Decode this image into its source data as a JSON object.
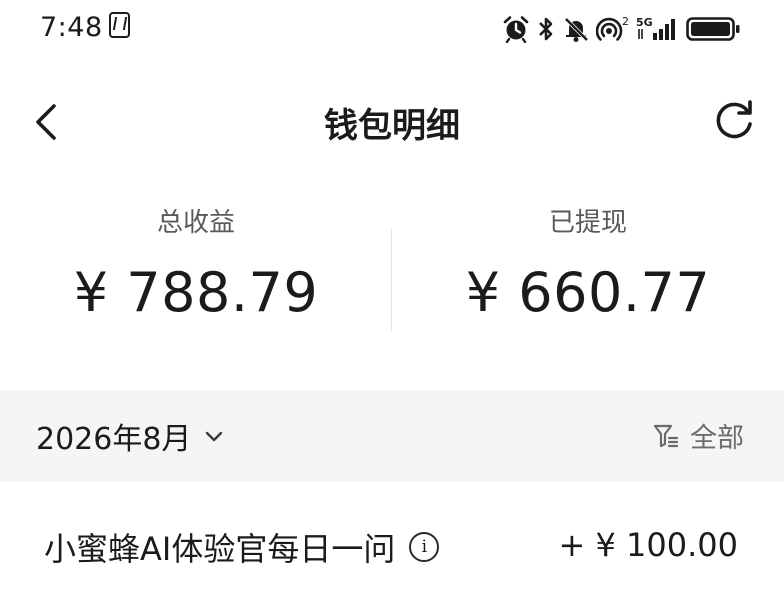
{
  "status_bar": {
    "time": "7:48",
    "network_badge": "5G",
    "hotspot_badge": "2"
  },
  "header": {
    "title": "钱包明细"
  },
  "summary": {
    "total_income_label": "总收益",
    "total_income_value": "¥ 788.79",
    "withdrawn_label": "已提现",
    "withdrawn_value": "¥ 660.77"
  },
  "filter": {
    "month": "2026年8月",
    "type_label": "全部"
  },
  "records": [
    {
      "title": "小蜜蜂AI体验官每日一问",
      "amount": "+ ¥ 100.00"
    }
  ],
  "colors": {
    "text_primary": "#1b1b1b",
    "text_secondary": "#6b6b6b",
    "filter_bg": "#f3f5f6"
  }
}
